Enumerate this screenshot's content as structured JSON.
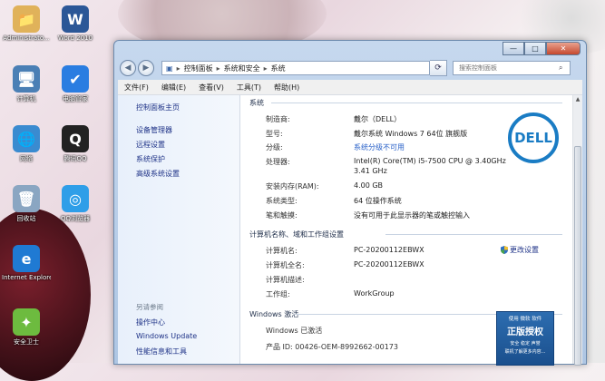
{
  "desktop": {
    "icons": [
      {
        "label": "Administrato...",
        "glyph": "📁",
        "color": "#e0b25a"
      },
      {
        "label": "Word 2010",
        "glyph": "W",
        "color": "#2b5797"
      },
      {
        "label": "计算机",
        "glyph": "🖥",
        "color": "#4a7fb5"
      },
      {
        "label": "电脑管家",
        "glyph": "✔",
        "color": "#2a7de1"
      },
      {
        "label": "网络",
        "glyph": "🌐",
        "color": "#3a8bd0"
      },
      {
        "label": "腾讯QQ",
        "glyph": "Q",
        "color": "#222222"
      },
      {
        "label": "回收站",
        "glyph": "🗑",
        "color": "#8aa6c2"
      },
      {
        "label": "QQ浏览器",
        "glyph": "◎",
        "color": "#2f9ee8"
      },
      {
        "label": "Internet Explorer",
        "glyph": "e",
        "color": "#1f7ad3"
      },
      {
        "label": "安全卫士",
        "glyph": "✦",
        "color": "#6dbb3f"
      }
    ]
  },
  "window": {
    "breadcrumb": [
      "控制面板",
      "系统和安全",
      "系统"
    ],
    "search_placeholder": "搜索控制面板",
    "controls": {
      "min": "—",
      "max": "□",
      "close": "✕"
    },
    "menu": [
      "文件(F)",
      "编辑(E)",
      "查看(V)",
      "工具(T)",
      "帮助(H)"
    ]
  },
  "left": {
    "home": "控制面板主页",
    "links": [
      "设备管理器",
      "远程设置",
      "系统保护",
      "高级系统设置"
    ],
    "see_also": "另请参阅",
    "bottom_links": [
      "操作中心",
      "Windows Update",
      "性能信息和工具"
    ]
  },
  "main": {
    "system_header": "系统",
    "system": [
      {
        "label": "制造商:",
        "value": "戴尔（DELL）"
      },
      {
        "label": "型号:",
        "value": "戴尔系统 Windows 7 64位 旗舰版"
      },
      {
        "label": "分级:",
        "value": "系统分级不可用",
        "link": true
      },
      {
        "label": "处理器:",
        "value": "Intel(R) Core(TM) i5-7500 CPU @ 3.40GHz",
        "value2": "3.41 GHz"
      },
      {
        "label": "安装内存(RAM):",
        "value": "4.00 GB"
      },
      {
        "label": "系统类型:",
        "value": "64 位操作系统"
      },
      {
        "label": "笔和触摸:",
        "value": "没有可用于此显示器的笔或触控输入"
      }
    ],
    "computer_header": "计算机名称、域和工作组设置",
    "computer": [
      {
        "label": "计算机名:",
        "value": "PC-20200112EBWX"
      },
      {
        "label": "计算机全名:",
        "value": "PC-20200112EBWX"
      },
      {
        "label": "计算机描述:",
        "value": ""
      },
      {
        "label": "工作组:",
        "value": "WorkGroup"
      }
    ],
    "change_settings": "更改设置",
    "activation_header": "Windows 激活",
    "activation_status": "Windows 已激活",
    "product_id": "产品 ID: 00426-OEM-8992662-00173",
    "logo_text": "DELL",
    "genuine": {
      "line1": "使用 微软 软件",
      "line2": "正版授权",
      "line3": "安全 稳定 声誉",
      "line4": "联机了解更多内容..."
    }
  }
}
